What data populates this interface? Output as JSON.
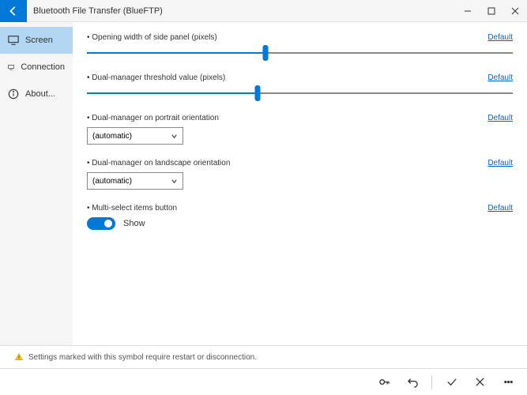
{
  "titlebar": {
    "title": "Bluetooth File Transfer (BlueFTP)"
  },
  "sidebar": {
    "items": [
      {
        "label": "Screen"
      },
      {
        "label": "Connection"
      },
      {
        "label": "About..."
      }
    ]
  },
  "settings": {
    "open_width": {
      "label": "Opening width of side panel (pixels)",
      "default": "Default",
      "pct": 42
    },
    "dual_thresh": {
      "label": "Dual-manager threshold value (pixels)",
      "default": "Default",
      "pct": 40
    },
    "dual_portrait": {
      "label": "Dual-manager on portrait orientation",
      "default": "Default",
      "value": "(automatic)"
    },
    "dual_landscape": {
      "label": "Dual-manager on landscape orientation",
      "default": "Default",
      "value": "(automatic)"
    },
    "multiselect": {
      "label": "Multi-select items button",
      "default": "Default",
      "state": "Show"
    }
  },
  "footer": {
    "note": "Settings marked with this symbol require restart or disconnection."
  }
}
